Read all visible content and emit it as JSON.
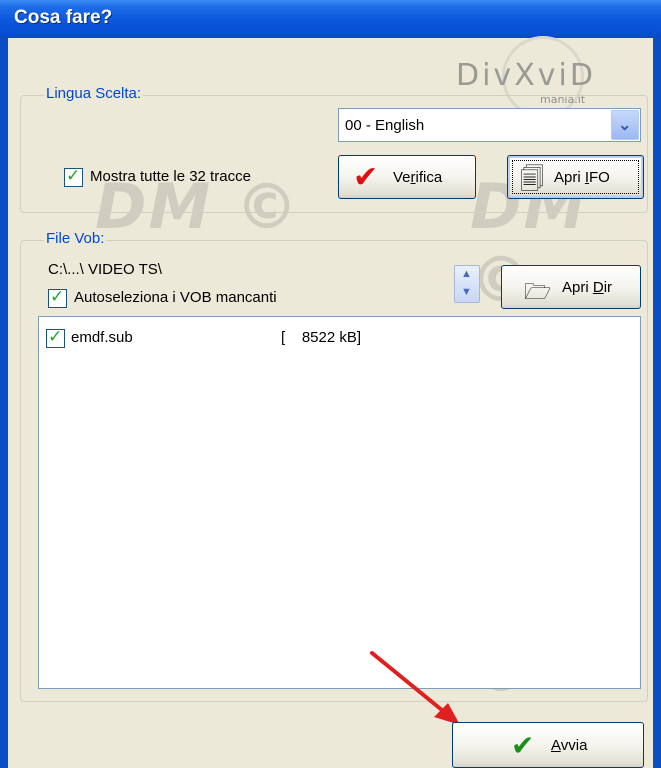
{
  "window": {
    "title": "Cosa fare?"
  },
  "watermark": {
    "logo": "DivXviD",
    "site": "mania.it",
    "text": "DM ©"
  },
  "lingua": {
    "group_label": "Lingua Scelta:",
    "selected": "00 - English",
    "show_all_label": "Mostra tutte le 32 tracce",
    "show_all_checked": true,
    "verifica": {
      "prefix": "Ve",
      "accel": "r",
      "suffix": "ifica"
    },
    "apri_ifo": {
      "prefix": "Apri ",
      "accel": "I",
      "suffix": "FO"
    }
  },
  "vob": {
    "group_label": "File Vob:",
    "path": "C:\\...\\ VIDEO  TS\\",
    "autoselect_label": "Autoseleziona i VOB mancanti",
    "autoselect_checked": true,
    "apri_dir": {
      "prefix": "Apri ",
      "accel": "D",
      "suffix": "ir"
    },
    "files": [
      {
        "name": "emdf.sub",
        "size": "[    8522 kB]",
        "checked": true
      }
    ]
  },
  "avvia": {
    "accel": "A",
    "suffix": "vvia"
  },
  "colors": {
    "title_bar": "#0a56dc",
    "group_label": "#0046d5",
    "check_mark": "#21a121",
    "arrow": "#e02020"
  }
}
